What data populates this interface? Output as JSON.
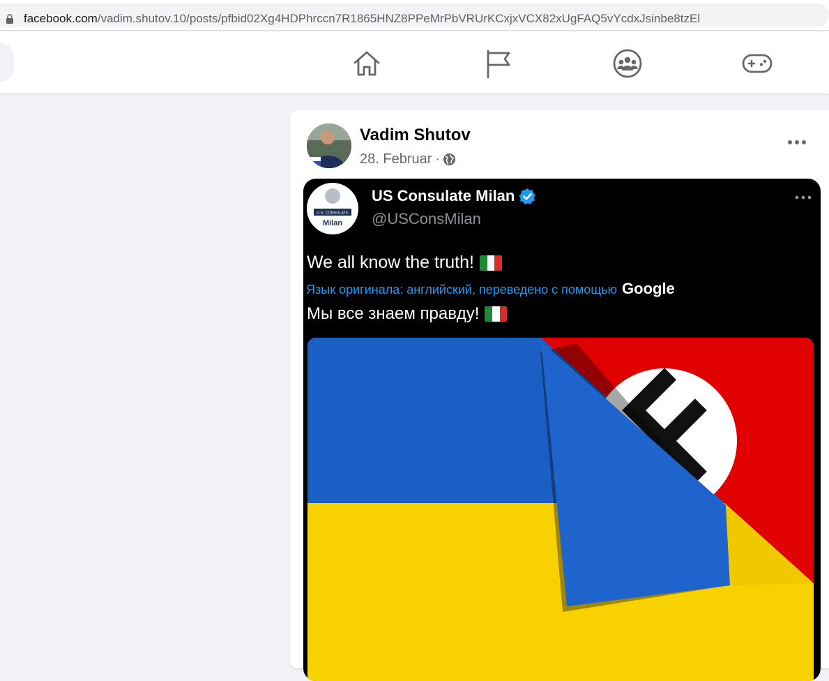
{
  "browser": {
    "url_host": "facebook.com",
    "url_path": "/vadim.shutov.10/posts/pfbid02Xg4HDPhrccn7R1865HNZ8PPeMrPbVRUrKCxjxVCX82xUgFAQ5vYcdxJsinbe8tzEl"
  },
  "topnav": {
    "icons": [
      "home-icon",
      "pages-flag-icon",
      "groups-icon",
      "gaming-icon"
    ]
  },
  "post": {
    "author": "Vadim Shutov",
    "date": "28. Februar",
    "separator": "·",
    "audience_icon": "globe-icon",
    "more_icon": "more-options-icon"
  },
  "tweet": {
    "name": "US Consulate Milan",
    "handle": "@USConsMilan",
    "avatar_text_top": "U.S. CONSULATE",
    "avatar_text_bottom": "Milan",
    "text": "We all know the truth!",
    "translation_note": "Язык оригинала: английский, переведено с помощью",
    "translation_brand": "Google",
    "text_translated": "Мы все знаем правду!",
    "colors": {
      "verified": "#1d9bf0",
      "ukraine_blue": "#1c5fc4",
      "ukraine_yellow": "#f7d200",
      "nazi_red": "#e10000"
    }
  }
}
